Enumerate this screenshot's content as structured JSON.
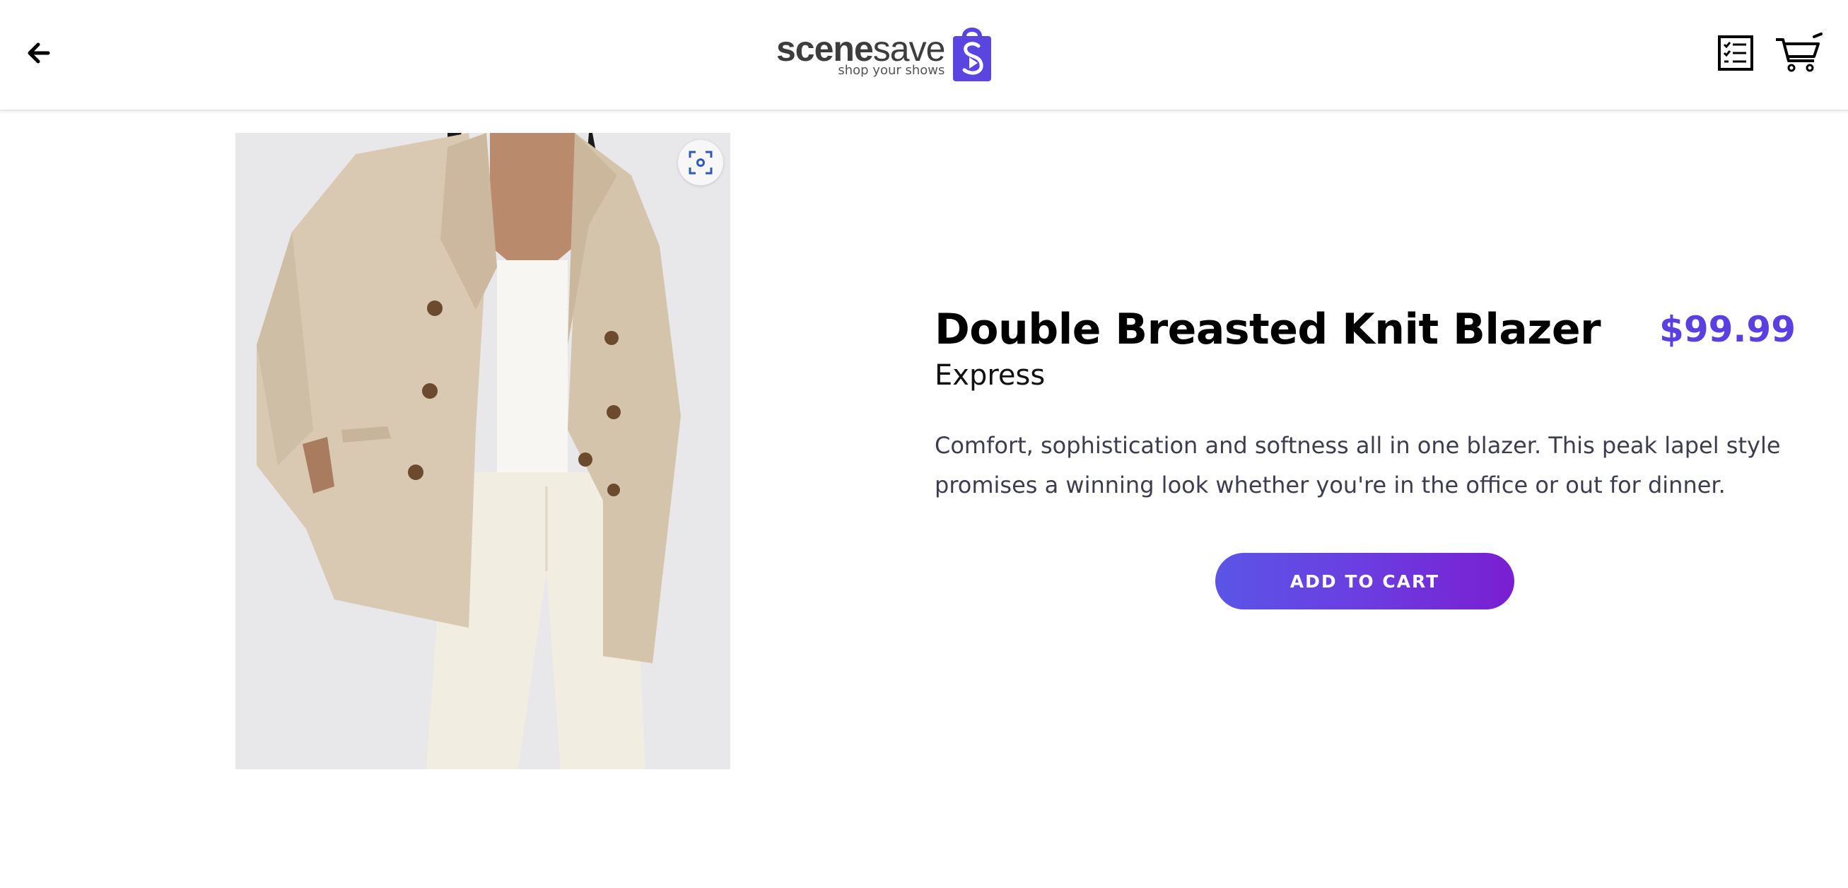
{
  "app": {
    "logo": {
      "word_bold": "scene",
      "word_light": "save",
      "tagline": "shop your shows",
      "icon": "shopping-bag-play-icon"
    }
  },
  "header": {
    "back_icon": "arrow-left-icon",
    "orders_icon": "checklist-icon",
    "cart_icon": "shopping-cart-icon"
  },
  "product": {
    "name": "Double Breasted Knit Blazer",
    "brand": "Express",
    "price": "$99.99",
    "description": "Comfort, sophistication and softness all in one blazer. This peak lapel style promises a winning look whether you're in the office or out for dinner.",
    "image_alt": "Beige double breasted knit blazer worn over white top and cream jeans",
    "scan_icon": "scan-focus-icon"
  },
  "actions": {
    "add_to_cart_label": "ADD TO CART"
  },
  "colors": {
    "accent": "#5b3fe0",
    "button_gradient_start": "#5b55e6",
    "button_gradient_end": "#7a1ed1",
    "logo_icon": "#5a45e0"
  }
}
